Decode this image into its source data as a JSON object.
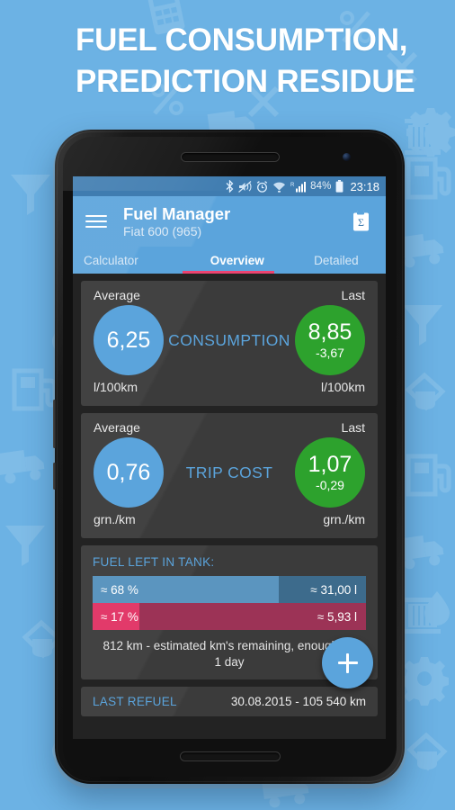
{
  "promo": {
    "title_line1": "FUEL CONSUMPTION,",
    "title_line2": "PREDICTION RESIDUE",
    "background_color": "#6cb2e4",
    "title_color": "#ffffff"
  },
  "status_bar": {
    "battery_percent": "84%",
    "clock": "23:18",
    "roaming_letter": "R",
    "icons": [
      "bluetooth-icon",
      "volume-muted-vibrate-icon",
      "alarm-icon",
      "wifi-icon",
      "cellular-signal-icon",
      "battery-icon"
    ],
    "background_color": "#3f7cb0"
  },
  "appbar": {
    "menu_icon": "hamburger-menu-icon",
    "title": "Fuel Manager",
    "subtitle": "Fiat 600 (965)",
    "action_icon": "statistics-clipboard-sigma-icon",
    "background_color": "#5ba4dc"
  },
  "tabs": {
    "items": [
      {
        "label": "Calculator",
        "active": false
      },
      {
        "label": "Overview",
        "active": true
      },
      {
        "label": "Detailed",
        "active": false
      }
    ],
    "indicator_color": "#ec4370"
  },
  "cards": {
    "consumption": {
      "name": "CONSUMPTION",
      "average_label": "Average",
      "last_label": "Last",
      "average_value": "6,25",
      "last_value": "8,85",
      "last_delta": "-3,67",
      "average_unit": "l/100km",
      "last_unit": "l/100km",
      "average_color": "#5ba4dc",
      "last_color": "#2da22d"
    },
    "trip_cost": {
      "name": "TRIP COST",
      "average_label": "Average",
      "last_label": "Last",
      "average_value": "0,76",
      "last_value": "1,07",
      "last_delta": "-0,29",
      "average_unit": "grn./km",
      "last_unit": "grn./km",
      "average_color": "#5ba4dc",
      "last_color": "#2da22d"
    },
    "fuel_left": {
      "heading": "FUEL LEFT IN TANK:",
      "bars": [
        {
          "percent_label": "≈ 68 %",
          "amount_label": "≈ 31,00 l",
          "fill_percent": 68,
          "fill_color": "#5b95bf",
          "track_color": "#3d6b8c"
        },
        {
          "percent_label": "≈ 17 %",
          "amount_label": "≈ 5,93 l",
          "fill_percent": 17,
          "fill_color": "#e23a6a",
          "track_color": "#9c3356"
        }
      ],
      "note": "812 km - estimated km's remaining, enough for 1 day"
    },
    "last_refuel": {
      "label": "LAST REFUEL",
      "value": "30.08.2015 - 105 540 km"
    }
  },
  "fab": {
    "icon": "plus-icon",
    "color": "#5ba4dc"
  }
}
